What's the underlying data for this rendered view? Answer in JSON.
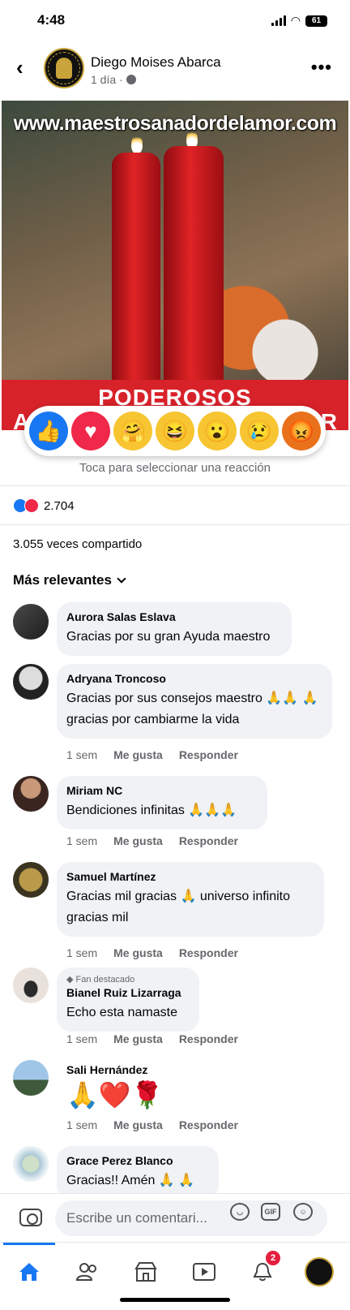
{
  "status": {
    "time": "4:48",
    "battery": "61"
  },
  "post": {
    "author": "Diego Moises Abarca",
    "time": "1 día",
    "image_watermark": "www.maestrosanadordelamor.com",
    "banner_line1": "PODEROSOS",
    "banner_line2_left": "A",
    "banner_line2_right": "R"
  },
  "reactions": {
    "items": [
      {
        "name": "like",
        "glyph": "👍"
      },
      {
        "name": "love",
        "glyph": "♥"
      },
      {
        "name": "care",
        "glyph": "🤗"
      },
      {
        "name": "haha",
        "glyph": "😆"
      },
      {
        "name": "wow",
        "glyph": "😮"
      },
      {
        "name": "sad",
        "glyph": "😢"
      },
      {
        "name": "angry",
        "glyph": "😡"
      }
    ],
    "hint": "Toca para seleccionar una reacción",
    "count": "2.704"
  },
  "shares": "3.055 veces compartido",
  "sort_label": "Más relevantes",
  "comments": [
    {
      "name": "Aurora Salas Eslava",
      "text": "Gracias por su gran Ayuda maestro",
      "time": "",
      "like": "",
      "reply": ""
    },
    {
      "name": "Adryana Troncoso",
      "text": "Gracias por sus consejos maestro 🙏🙏 🙏 gracias por cambiarme la vida",
      "time": "1 sem",
      "like": "Me gusta",
      "reply": "Responder"
    },
    {
      "name": "Miriam NC",
      "text": "Bendiciones infinitas 🙏🙏🙏",
      "time": "1 sem",
      "like": "Me gusta",
      "reply": "Responder"
    },
    {
      "name": "Samuel Martínez",
      "text": "Gracias mil gracias 🙏 universo infinito gracias mil",
      "time": "1 sem",
      "like": "Me gusta",
      "reply": "Responder"
    },
    {
      "name": "Bianel Ruiz Lizarraga",
      "fan": "Fan destacado",
      "text": "Echo esta namaste",
      "time": "1 sem",
      "like": "Me gusta",
      "reply": "Responder"
    },
    {
      "name": "Sali Hernández",
      "text": "🙏❤️🌹",
      "time": "1 sem",
      "like": "Me gusta",
      "reply": "Responder"
    },
    {
      "name": "Grace Perez Blanco",
      "text": "Gracias!! Amén 🙏 🙏",
      "time": "",
      "like": "",
      "reply": ""
    }
  ],
  "composer": {
    "placeholder": "Escribe un comentari...",
    "gif": "GIF"
  },
  "tabs": {
    "notifications_badge": "2"
  },
  "colors": {
    "accent": "#1877f2",
    "banner": "#d8222a"
  }
}
